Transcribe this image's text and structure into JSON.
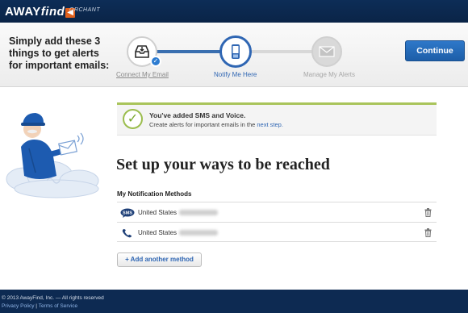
{
  "brand": {
    "logo_away": "AWAY",
    "logo_find": "find",
    "logo_tag": "ORCHANT"
  },
  "steps_header": {
    "intro_text": "Simply add these 3 things to get alerts for important emails:",
    "steps": [
      {
        "label": "Connect My Email",
        "state": "done",
        "icon": "inbox-icon"
      },
      {
        "label": "Notify Me Here",
        "state": "current",
        "icon": "phone-icon"
      },
      {
        "label": "Manage My Alerts",
        "state": "upcoming",
        "icon": "envelope-icon"
      }
    ],
    "continue_label": "Continue"
  },
  "notice": {
    "title": "You've added SMS and Voice.",
    "body_prefix": "Create alerts for important emails in the ",
    "link_text": "next step.",
    "accent_color": "#a9c45b"
  },
  "main": {
    "heading": "Set up your ways to be reached",
    "methods_title": "My Notification Methods",
    "methods": [
      {
        "type": "SMS",
        "icon": "sms-icon",
        "country": "United States",
        "number_redacted": true
      },
      {
        "type": "Voice",
        "icon": "phone-handset-icon",
        "country": "United States",
        "number_redacted": true
      }
    ],
    "add_button": "+ Add another method"
  },
  "footer": {
    "copyright": "© 2013 AwayFind, Inc. — All rights reserved",
    "privacy": "Privacy Policy",
    "separator": "|",
    "terms": "Terms of Service"
  },
  "colors": {
    "header_bg": "#0d2d57",
    "primary_blue": "#2f66b3",
    "footer_bg": "#0d2a52"
  }
}
